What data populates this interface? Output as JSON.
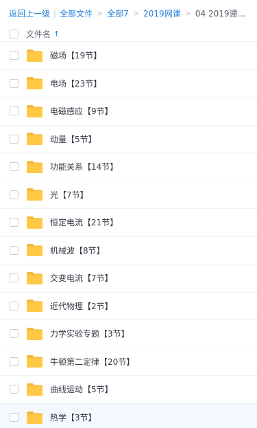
{
  "breadcrumb": {
    "back": "返回上一级",
    "items": [
      "全部文件",
      "全部7",
      "2019网课"
    ],
    "current": "04 2019谭..."
  },
  "header": {
    "column_label": "文件名",
    "sort_icon": "arrow-up-icon"
  },
  "folder_icon": "folder-icon",
  "colors": {
    "accent": "#1f7fd6",
    "folder": "#ffc845",
    "highlight_row": "#f3f9fe"
  },
  "files": [
    {
      "name": "磁场【19节】"
    },
    {
      "name": "电场【23节】"
    },
    {
      "name": "电磁感应【9节】"
    },
    {
      "name": "动量【5节】"
    },
    {
      "name": "功能关系【14节】"
    },
    {
      "name": "光【7节】"
    },
    {
      "name": "恒定电流【21节】"
    },
    {
      "name": "机械波【8节】"
    },
    {
      "name": "交变电流【7节】"
    },
    {
      "name": "近代物理【2节】"
    },
    {
      "name": "力学实验专题【3节】"
    },
    {
      "name": "牛顿第二定律【20节】"
    },
    {
      "name": "曲线运动【5节】"
    },
    {
      "name": "热学【3节】"
    }
  ]
}
